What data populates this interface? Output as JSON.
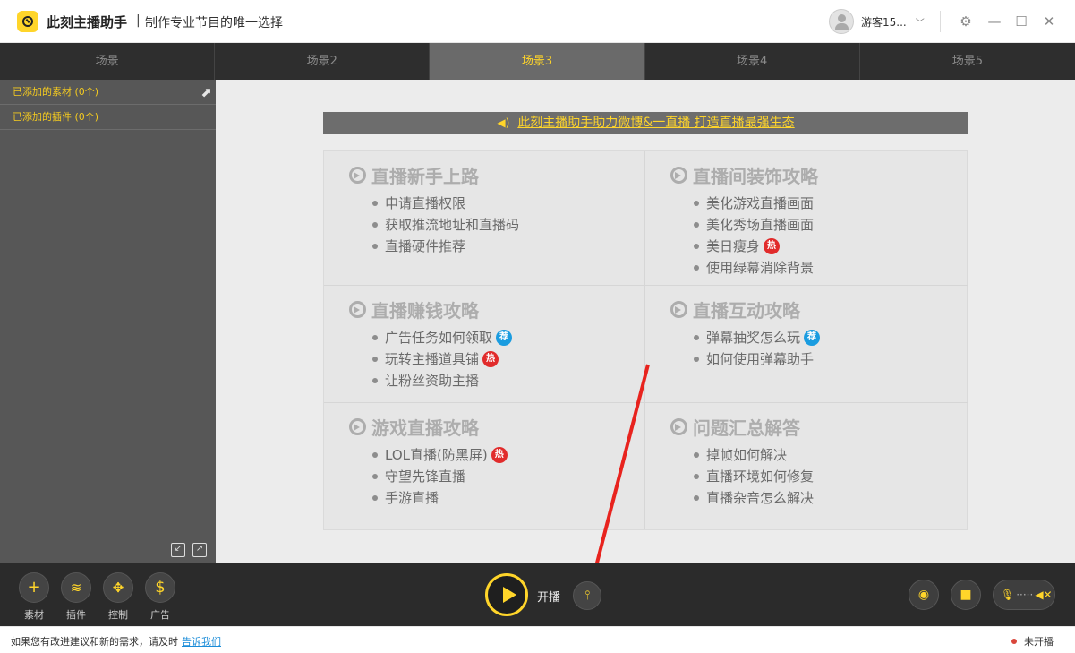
{
  "app": {
    "name": "此刻主播助手",
    "separator": "|",
    "slogan": "制作专业节目的唯一选择",
    "username": "游客15...",
    "window_controls": [
      "gear-icon",
      "minimize-icon",
      "maximize-icon",
      "close-icon"
    ]
  },
  "tabs": [
    {
      "label": "场景",
      "active": false
    },
    {
      "label": "场景2",
      "active": false
    },
    {
      "label": "场景3",
      "active": true
    },
    {
      "label": "场景4",
      "active": false
    },
    {
      "label": "场景5",
      "active": false
    }
  ],
  "sidebar": {
    "materials_label": "已添加的素材 (0个)",
    "plugins_label": "已添加的插件 (0个)"
  },
  "banner": {
    "text": "此刻主播助手助力微博&一直播 打造直播最强生态"
  },
  "guides": [
    {
      "title": "直播新手上路",
      "items": [
        {
          "text": "申请直播权限",
          "badge": ""
        },
        {
          "text": "获取推流地址和直播码",
          "badge": ""
        },
        {
          "text": "直播硬件推荐",
          "badge": ""
        }
      ]
    },
    {
      "title": "直播间装饰攻略",
      "items": [
        {
          "text": "美化游戏直播画面",
          "badge": ""
        },
        {
          "text": "美化秀场直播画面",
          "badge": ""
        },
        {
          "text": "美日瘦身",
          "badge": "热"
        },
        {
          "text": "使用绿幕消除背景",
          "badge": ""
        }
      ]
    },
    {
      "title": "直播赚钱攻略",
      "items": [
        {
          "text": "广告任务如何领取",
          "badge": "荐"
        },
        {
          "text": "玩转主播道具铺",
          "badge": "热"
        },
        {
          "text": "让粉丝资助主播",
          "badge": ""
        }
      ]
    },
    {
      "title": "直播互动攻略",
      "items": [
        {
          "text": "弹幕抽奖怎么玩",
          "badge": "荐"
        },
        {
          "text": "如何使用弹幕助手",
          "badge": ""
        }
      ]
    },
    {
      "title": "游戏直播攻略",
      "items": [
        {
          "text": "LOL直播(防黑屏)",
          "badge": "热"
        },
        {
          "text": "守望先锋直播",
          "badge": ""
        },
        {
          "text": "手游直播",
          "badge": ""
        }
      ]
    },
    {
      "title": "问题汇总解答",
      "items": [
        {
          "text": "掉帧如何解决",
          "badge": ""
        },
        {
          "text": "直播环境如何修复",
          "badge": ""
        },
        {
          "text": "直播杂音怎么解决",
          "badge": ""
        }
      ]
    }
  ],
  "toolbar": {
    "left_tools": [
      {
        "label": "素材",
        "icon": "plus-icon"
      },
      {
        "label": "插件",
        "icon": "layers-icon"
      },
      {
        "label": "控制",
        "icon": "move-icon"
      },
      {
        "label": "广告",
        "icon": "dollar-icon"
      }
    ],
    "start_label": "开播"
  },
  "status": {
    "message": "如果您有改进建议和新的需求，请及时",
    "link": "告诉我们",
    "live_status": "未开播"
  },
  "colors": {
    "accent": "#ffd52a",
    "dark_bar": "#2b2b2b",
    "hot_badge": "#e12b2b",
    "rec_badge": "#1a9ce0"
  }
}
